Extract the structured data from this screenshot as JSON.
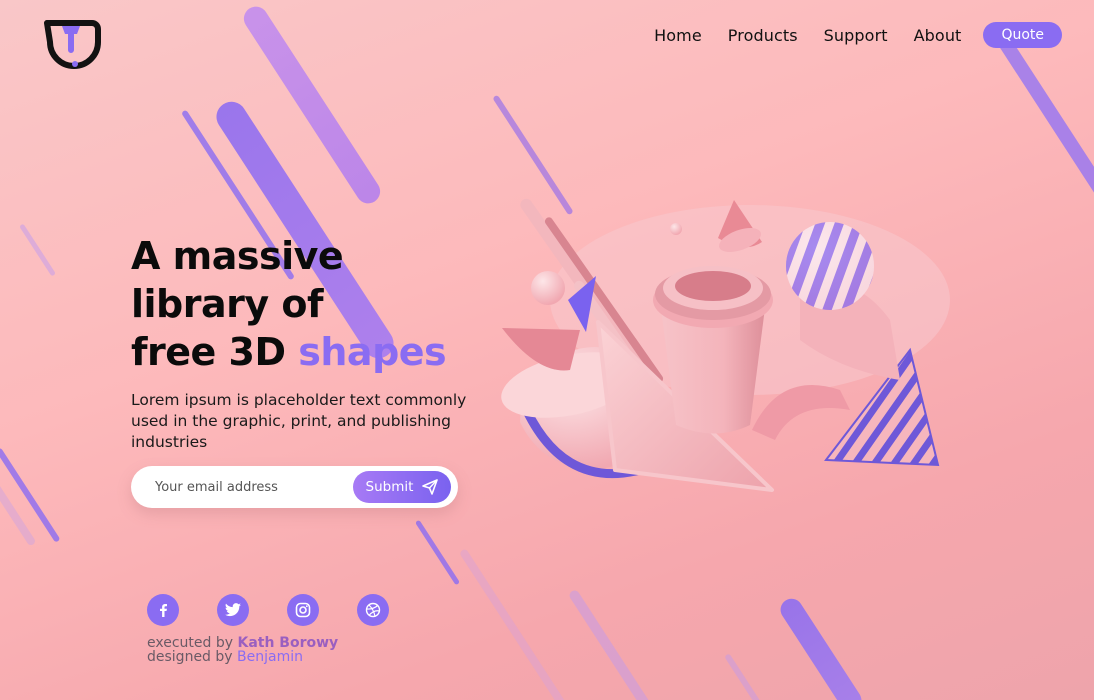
{
  "colors": {
    "accent": "#8a6cf2",
    "background": "#fdb9bb"
  },
  "logo": {
    "icon": "brand-logo-icon"
  },
  "nav": {
    "links": [
      "Home",
      "Products",
      "Support",
      "About"
    ],
    "cta": "Quote"
  },
  "hero": {
    "title_line1": "A massive",
    "title_line2": "library of",
    "title_line3_plain": "free 3D ",
    "title_line3_accent": "shapes",
    "description": "Lorem ipsum is placeholder text commonly used in the graphic, print, and publishing industries"
  },
  "subscribe": {
    "placeholder": "Your email address",
    "submit_label": "Submit",
    "submit_icon": "paper-plane-icon"
  },
  "social": [
    "facebook-icon",
    "twitter-icon",
    "instagram-icon",
    "dribbble-icon"
  ],
  "credits": {
    "executed_prefix": "executed by ",
    "executed_name": "Kath Borowy",
    "designed_prefix": "designed by ",
    "designed_name": "Benjamin"
  }
}
